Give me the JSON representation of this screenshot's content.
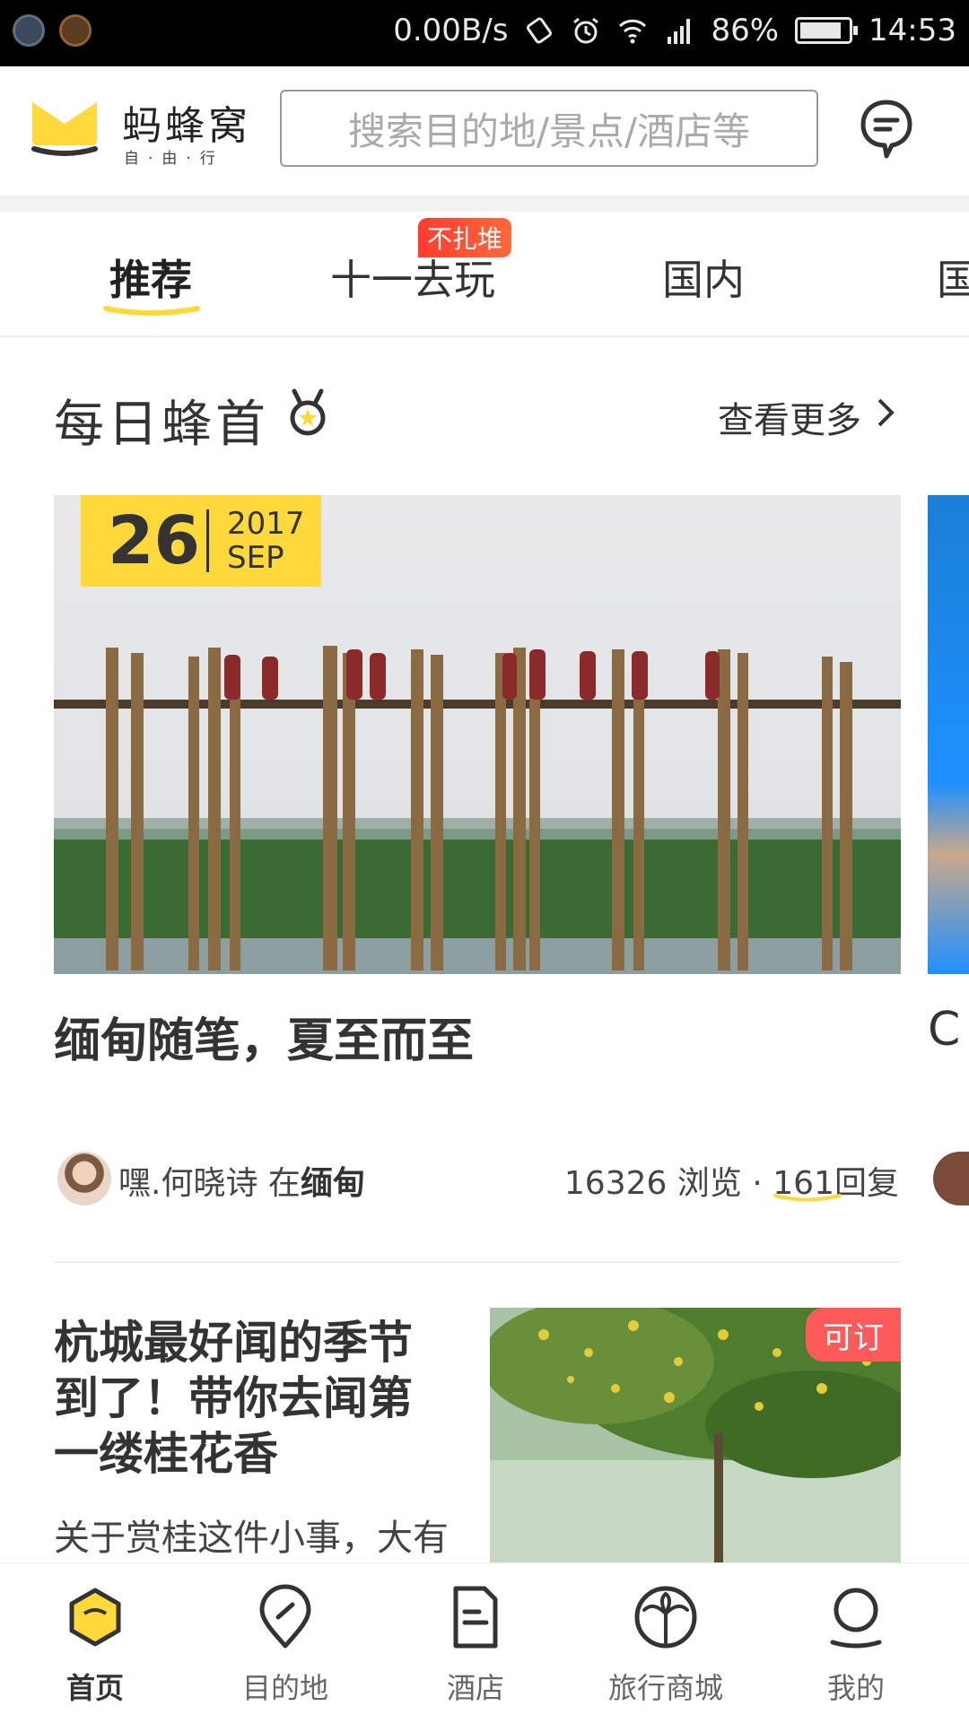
{
  "status_bar": {
    "speed": "0.00B/s",
    "battery_text": "86%",
    "battery_level": 0.86,
    "time": "14:53"
  },
  "header": {
    "logo_title": "蚂蜂窝",
    "logo_subtitle": "自·由·行",
    "search_placeholder": "搜索目的地/景点/酒店等"
  },
  "tabs": {
    "items": [
      "推荐",
      "十一去玩",
      "国内",
      "国"
    ],
    "badge": "不扎堆"
  },
  "section": {
    "title": "每日蜂首",
    "see_more": "查看更多"
  },
  "featured": {
    "date_day": "26",
    "date_year": "2017",
    "date_month": "SEP",
    "title": "缅甸随笔，夏至而至",
    "next_title_fragment": "C",
    "author": "嘿.何晓诗",
    "author_in": "在",
    "location": "缅甸",
    "views": "16326",
    "views_label": "浏览",
    "dot": "·",
    "replies": "161",
    "replies_label": "回复"
  },
  "article": {
    "title": "杭城最好闻的季节到了！带你去闻第一缕桂花香",
    "desc": "关于赏桂这件小事，大有",
    "badge": "可订"
  },
  "bottom_nav": {
    "items": [
      "首页",
      "目的地",
      "酒店",
      "旅行商城",
      "我的"
    ]
  },
  "colors": {
    "brand_yellow": "#ffd93a",
    "badge_red": "#ff5a5a",
    "text_dark": "#333333"
  }
}
